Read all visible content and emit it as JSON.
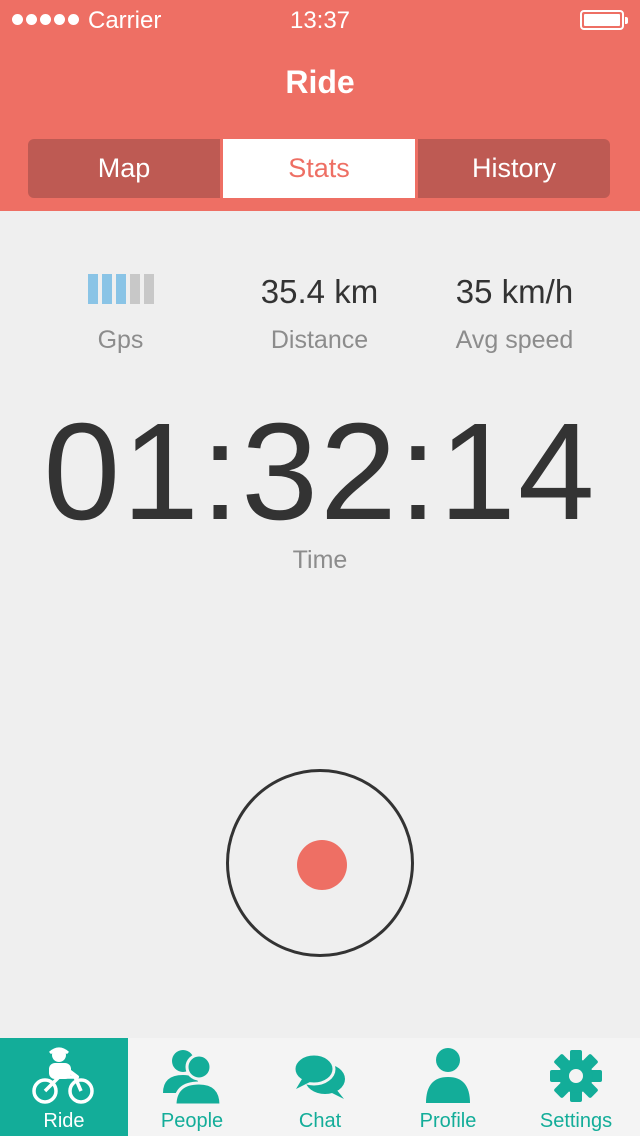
{
  "status_bar": {
    "carrier": "Carrier",
    "time": "13:37"
  },
  "nav": {
    "title": "Ride"
  },
  "segments": [
    {
      "label": "Map"
    },
    {
      "label": "Stats"
    },
    {
      "label": "History"
    }
  ],
  "segments_selected": "Stats",
  "stats": {
    "gps": {
      "label": "Gps",
      "signal_level": 3,
      "signal_max": 5
    },
    "distance": {
      "value": "35.4 km",
      "label": "Distance"
    },
    "speed": {
      "value": "35 km/h",
      "label": "Avg speed"
    }
  },
  "timer": {
    "value": "01:32:14",
    "label": "Time"
  },
  "tabs": [
    {
      "label": "Ride",
      "icon": "cyclist-icon"
    },
    {
      "label": "People",
      "icon": "people-icon"
    },
    {
      "label": "Chat",
      "icon": "chat-icon"
    },
    {
      "label": "Profile",
      "icon": "profile-icon"
    },
    {
      "label": "Settings",
      "icon": "gear-icon"
    }
  ],
  "tabs_selected": "Ride",
  "colors": {
    "accent": "#ee6f64",
    "teal": "#13ad99",
    "gps_on": "#8ac4e6"
  }
}
